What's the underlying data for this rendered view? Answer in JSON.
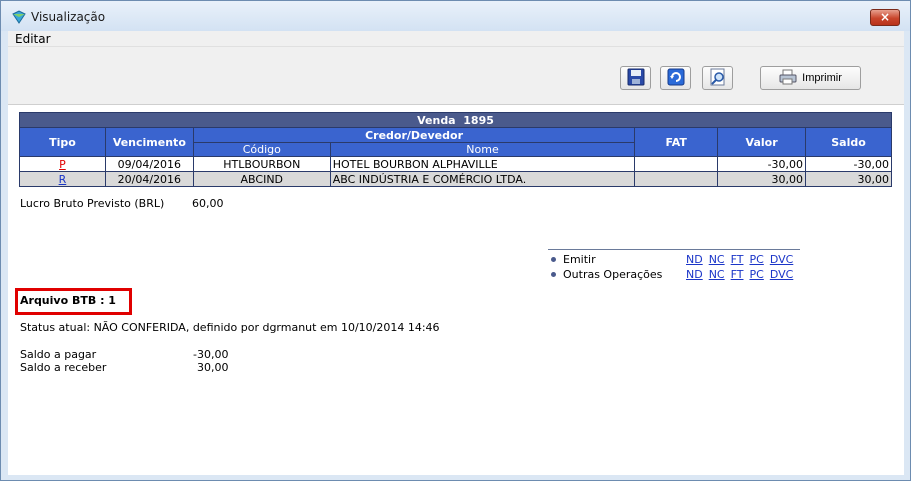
{
  "window": {
    "title": "Visualização",
    "close_glyph": "×"
  },
  "menu": {
    "edit": "Editar"
  },
  "toolbar": {
    "print_label": "Imprimir"
  },
  "venda": {
    "title": "Venda  1895",
    "headers": {
      "tipo": "Tipo",
      "vencimento": "Vencimento",
      "credor": "Credor/Devedor",
      "codigo": "Código",
      "nome": "Nome",
      "fat": "FAT",
      "valor": "Valor",
      "saldo": "Saldo"
    },
    "rows": [
      {
        "tipo": "P",
        "vencimento": "09/04/2016",
        "codigo": "HTLBOURBON",
        "nome": "HOTEL BOURBON ALPHAVILLE",
        "fat": "",
        "valor": "-30,00",
        "saldo": "-30,00"
      },
      {
        "tipo": "R",
        "vencimento": "20/04/2016",
        "codigo": "ABCIND",
        "nome": "ABC INDÚSTRIA E COMÉRCIO LTDA.",
        "fat": "",
        "valor": "30,00",
        "saldo": "30,00"
      }
    ]
  },
  "lucro": {
    "label": "Lucro Bruto Previsto (BRL)",
    "value": "60,00"
  },
  "operations": {
    "emitir": {
      "label": "Emitir",
      "links": [
        "ND",
        "NC",
        "FT",
        "PC",
        "DVC"
      ]
    },
    "outras": {
      "label": "Outras Operações",
      "links": [
        "ND",
        "NC",
        "FT",
        "PC",
        "DVC"
      ]
    }
  },
  "arquivo_btb": "Arquivo BTB : 1",
  "status": "Status atual: NÃO CONFERIDA, definido por dgrmanut em 10/10/2014 14:46",
  "saldo_pagar": {
    "label": "Saldo a pagar",
    "value": "-30,00"
  },
  "saldo_receber": {
    "label": "Saldo a receber",
    "value": "30,00"
  },
  "colors": {
    "table_title_bg": "#4a5a8c",
    "header_bg": "#3a64cf",
    "highlight_border": "#e00000",
    "link_blue": "#1a35c8",
    "link_red": "#e00000"
  },
  "icons": [
    "app-icon",
    "close-icon",
    "save-icon",
    "refresh-icon",
    "preview-icon",
    "printer-icon"
  ]
}
